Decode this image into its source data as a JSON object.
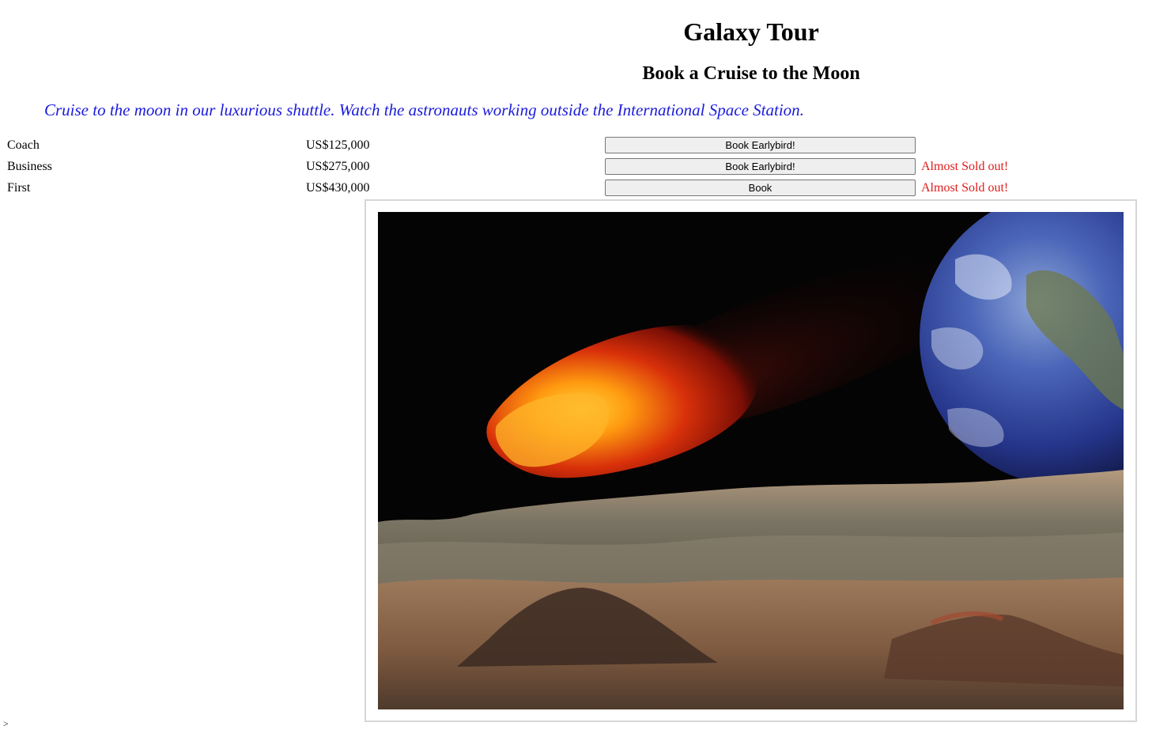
{
  "header": {
    "title": "Galaxy Tour",
    "subtitle": "Book a Cruise to the Moon"
  },
  "intro": "Cruise to the moon in our luxurious shuttle. Watch the astronauts working outside the International Space Station.",
  "fares": [
    {
      "class": "Coach",
      "price": "US$125,000",
      "button": "Book Earlybird!",
      "notice": ""
    },
    {
      "class": "Business",
      "price": "US$275,000",
      "button": "Book Earlybird!",
      "notice": "Almost Sold out!"
    },
    {
      "class": "First",
      "price": "US$430,000",
      "button": "Book",
      "notice": "Almost Sold out!"
    }
  ],
  "image": {
    "subject": "moon-landscape-with-fiery-meteor-and-earth"
  },
  "colors": {
    "intro_text": "#1b1bdc",
    "notice_text": "#e01b1b",
    "button_bg": "#efefef"
  }
}
